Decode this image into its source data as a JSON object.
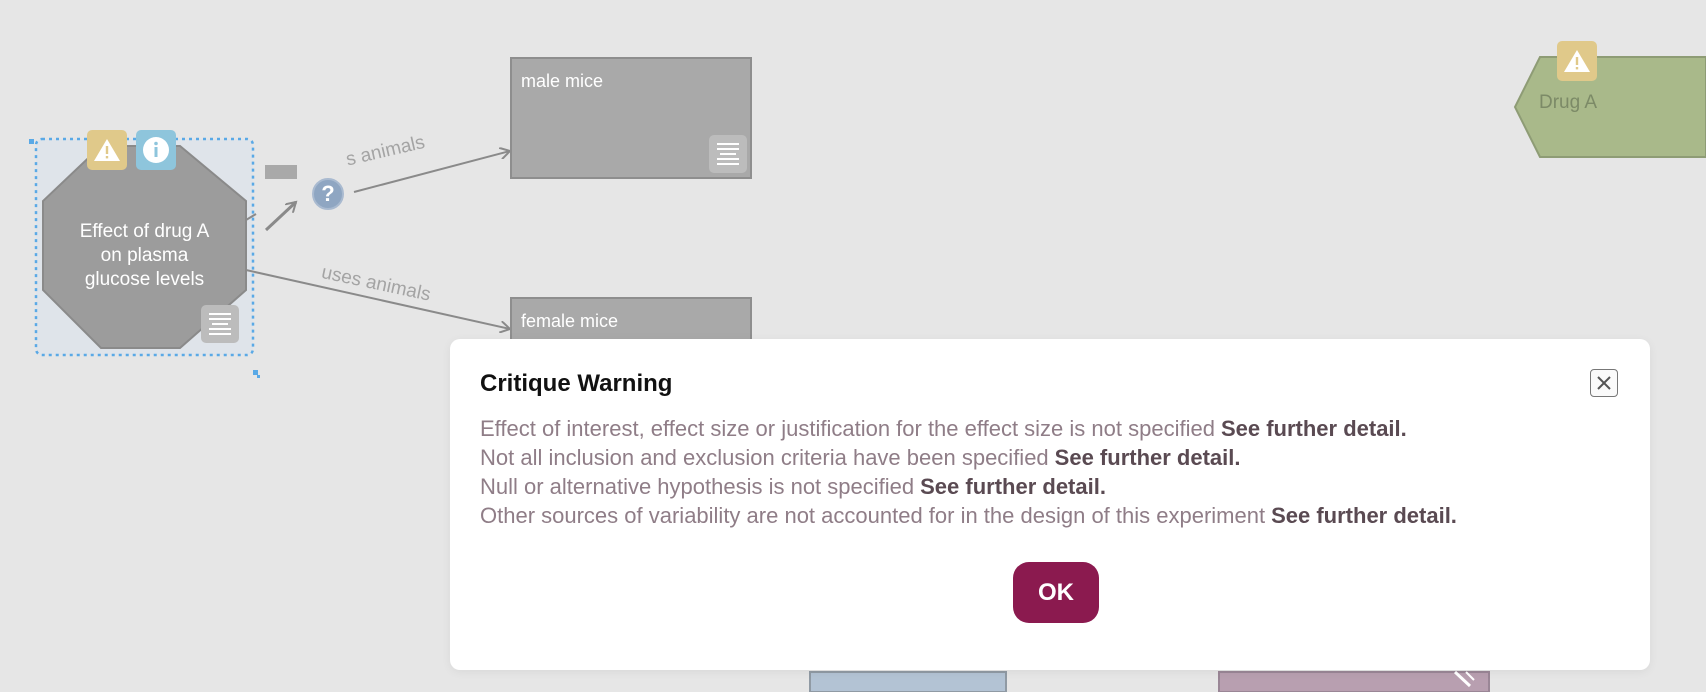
{
  "nodes": {
    "experiment": {
      "label": [
        "Effect of drug A",
        "on plasma",
        "glucose levels"
      ]
    },
    "male": {
      "label": "male mice"
    },
    "female": {
      "label": "female mice"
    },
    "drug": {
      "label": "Drug A"
    }
  },
  "edges": {
    "upper_label": "s animals",
    "lower_label": "uses animals"
  },
  "badges": {
    "warning_icon": "warning-triangle-icon",
    "info_icon": "info-icon",
    "help_icon": "question-icon",
    "note_icon": "note-lines-icon"
  },
  "dialog": {
    "title": "Critique Warning",
    "lines": [
      {
        "text": "Effect of interest, effect size or justification for the effect size is not specified",
        "link": "See further detail."
      },
      {
        "text": "Not all inclusion and exclusion criteria have been specified",
        "link": "See further detail."
      },
      {
        "text": "Null or alternative hypothesis is not specified",
        "link": "See further detail."
      },
      {
        "text": "Other sources of variability are not accounted for in the design of this experiment",
        "link": "See further detail."
      }
    ],
    "ok_label": "OK",
    "close_icon": "close-icon"
  },
  "colors": {
    "canvas_bg": "#e6e6e6",
    "node_gray": "#a9a9a9",
    "drug_green": "#a9b98a",
    "selection_blue": "#5aa9e6",
    "warning_yellow": "#e0c98a",
    "info_blue": "#8ec5dc",
    "ok_button": "#8b1a4f",
    "detail_text": "#8f7d87"
  }
}
